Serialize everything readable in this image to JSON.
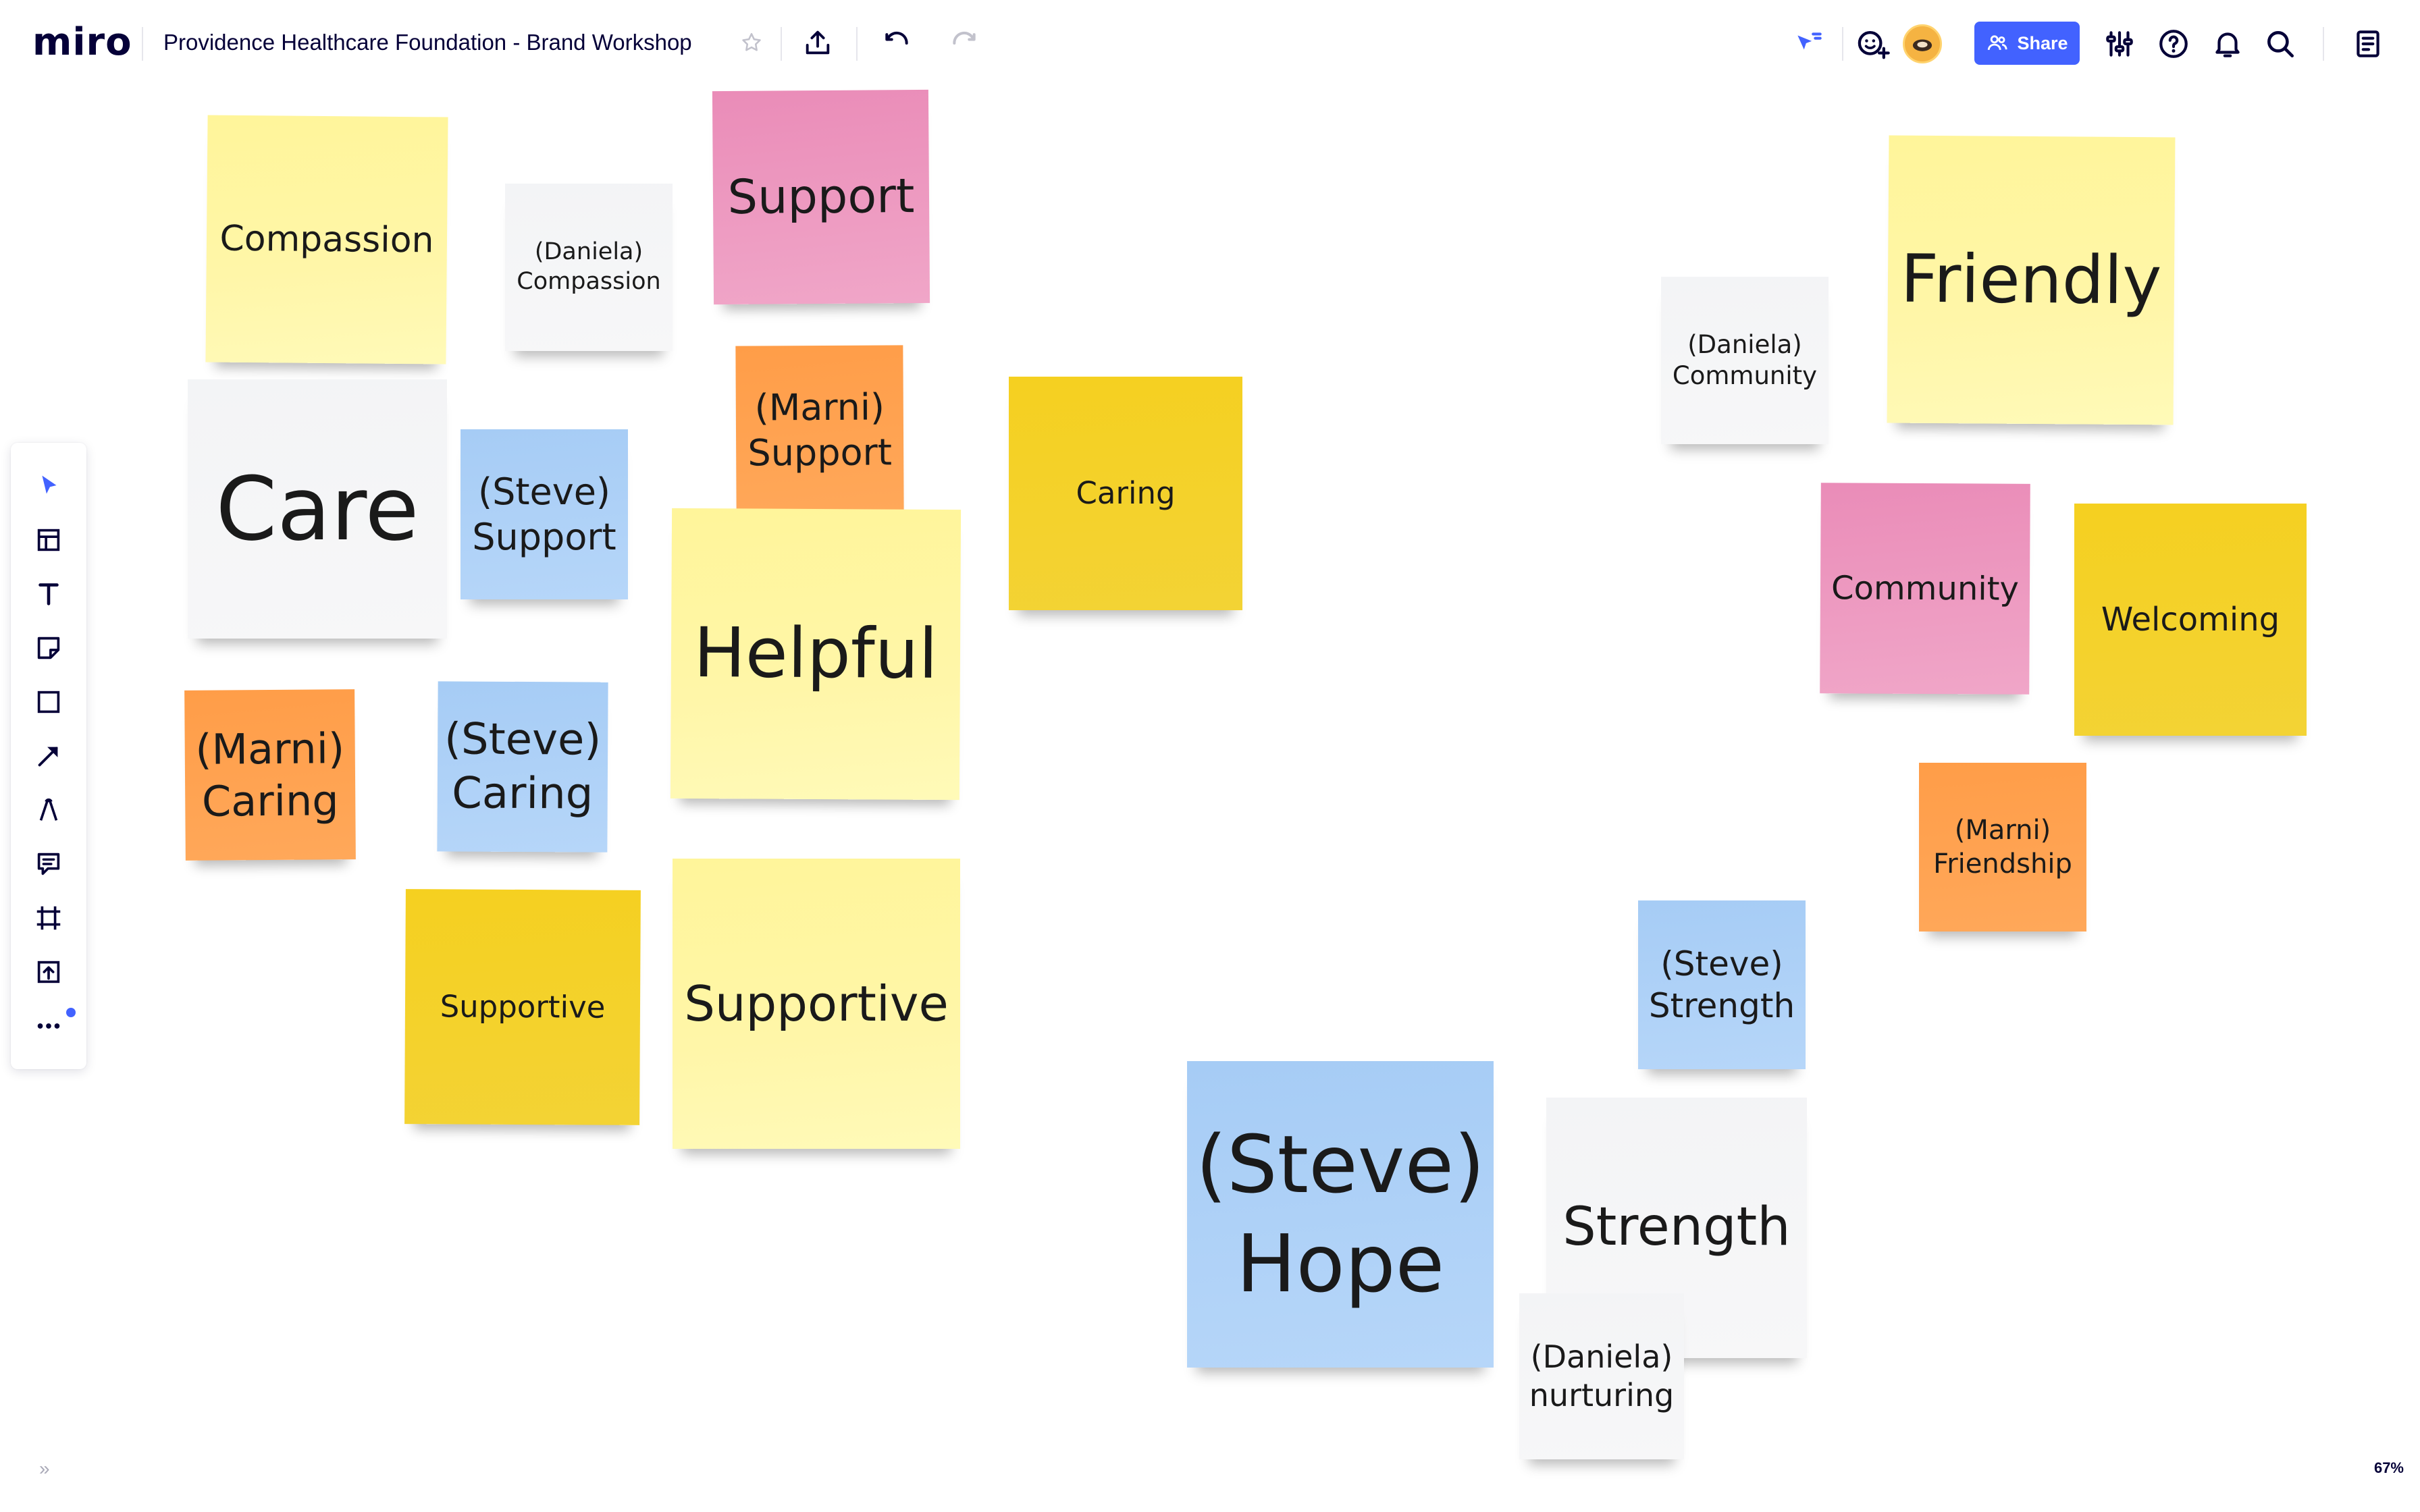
{
  "app": {
    "logo": "miro",
    "board_title": "Providence Healthcare Foundation - Brand Workshop",
    "share_label": "Share",
    "zoom": "67%",
    "accent": "#4262ff"
  },
  "topbar_icons": [
    "star-icon",
    "upload-icon",
    "undo-icon",
    "redo-icon",
    "cursor-follow-icon",
    "add-reaction-icon",
    "avatar",
    "settings-sliders-icon",
    "help-icon",
    "bell-icon",
    "search-icon",
    "notes-icon"
  ],
  "tools": [
    "select-tool-icon",
    "templates-tool-icon",
    "text-tool-icon",
    "sticky-note-tool-icon",
    "shape-tool-icon",
    "arrow-tool-icon",
    "pen-tool-icon",
    "comment-tool-icon",
    "frame-tool-icon",
    "upload-tool-icon",
    "more-tools-icon"
  ],
  "notes": [
    {
      "id": "compassion",
      "text": "Compassion",
      "color": "yellow-light"
    },
    {
      "id": "daniela-compassion",
      "text": "(Daniela)\nCompassion",
      "color": "white"
    },
    {
      "id": "support-pink",
      "text": "Support",
      "color": "pink"
    },
    {
      "id": "marni-support",
      "text": "(Marni)\nSupport",
      "color": "orange"
    },
    {
      "id": "care",
      "text": "Care",
      "color": "white"
    },
    {
      "id": "steve-support",
      "text": "(Steve)\nSupport",
      "color": "blue"
    },
    {
      "id": "caring",
      "text": "Caring",
      "color": "yellow"
    },
    {
      "id": "helpful",
      "text": "Helpful",
      "color": "yellow-light"
    },
    {
      "id": "marni-caring",
      "text": "(Marni)\nCaring",
      "color": "orange"
    },
    {
      "id": "steve-caring",
      "text": "(Steve)\nCaring",
      "color": "blue"
    },
    {
      "id": "supportive-yellow",
      "text": "Supportive",
      "color": "yellow"
    },
    {
      "id": "supportive-light",
      "text": "Supportive",
      "color": "yellow-light"
    },
    {
      "id": "daniela-community",
      "text": "(Daniela)\nCommunity",
      "color": "white"
    },
    {
      "id": "friendly",
      "text": "Friendly",
      "color": "yellow-light"
    },
    {
      "id": "community",
      "text": "Community",
      "color": "pink"
    },
    {
      "id": "welcoming",
      "text": "Welcoming",
      "color": "yellow"
    },
    {
      "id": "marni-friendship",
      "text": "(Marni)\nFriendship",
      "color": "orange"
    },
    {
      "id": "steve-strength",
      "text": "(Steve)\nStrength",
      "color": "blue"
    },
    {
      "id": "steve-hope",
      "text": "(Steve)\nHope",
      "color": "blue"
    },
    {
      "id": "strength",
      "text": "Strength",
      "color": "white"
    },
    {
      "id": "daniela-nurturing",
      "text": "(Daniela)\nnurturing",
      "color": "white"
    }
  ]
}
